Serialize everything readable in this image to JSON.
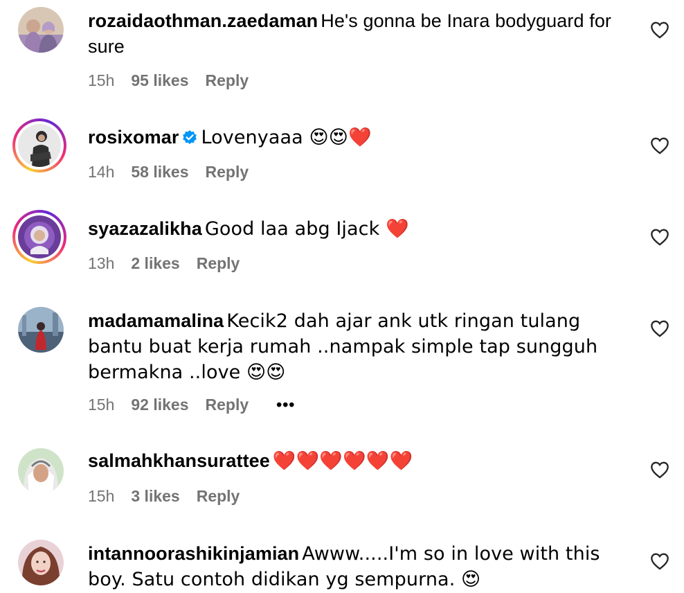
{
  "comments": [
    {
      "username": "rozaidaothman.zaedaman",
      "text": "He's gonna be Inara bodyguard for sure",
      "time": "15h",
      "likes": "95 likes",
      "reply": "Reply"
    },
    {
      "username": "rosixomar",
      "verified": true,
      "text": "Lovenyaaa 😍😍❤️",
      "time": "14h",
      "likes": "58 likes",
      "reply": "Reply"
    },
    {
      "username": "syazazalikha",
      "text": "Good laa abg Ijack ❤️",
      "time": "13h",
      "likes": "2 likes",
      "reply": "Reply"
    },
    {
      "username": "madamamalina",
      "text": "Kecik2 dah ajar ank utk ringan tulang bantu buat kerja rumah ..nampak simple tap sungguh bermakna ..love 😍😍",
      "time": "15h",
      "likes": "92 likes",
      "reply": "Reply",
      "more": "•••"
    },
    {
      "username": "salmahkhansurattee",
      "text": "❤️❤️❤️❤️❤️❤️",
      "time": "15h",
      "likes": "3 likes",
      "reply": "Reply"
    },
    {
      "username": "intannoorashikinjamian",
      "text": "Awww.....I'm so in love with this boy. Satu contoh didikan yg sempurna. 😍"
    }
  ],
  "icons": {
    "like": "heart-outline-icon",
    "verified": "verified-badge-icon"
  },
  "colors": {
    "meta_text": "#737373",
    "verified_blue": "#0095f6",
    "heart_red": "#e0245e"
  }
}
